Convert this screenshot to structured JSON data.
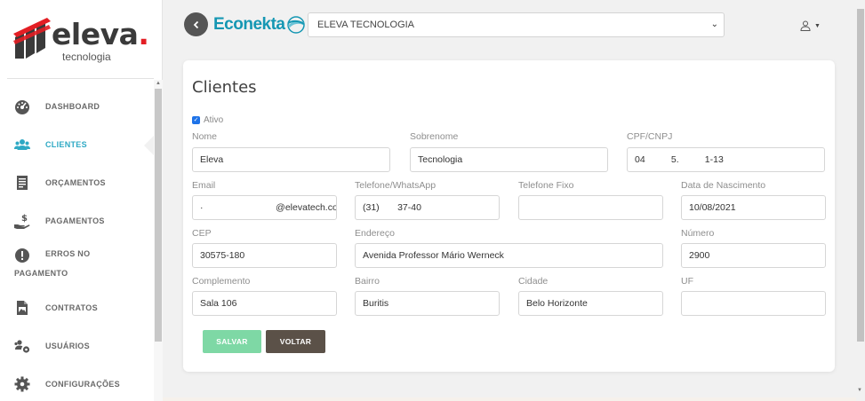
{
  "sidebar": {
    "logo_text": "eleva",
    "logo_dot": ".",
    "logo_sub": "tecnologia",
    "items": [
      {
        "label": "DASHBOARD",
        "icon": "dashboard-gauge-icon"
      },
      {
        "label": "CLIENTES",
        "icon": "users-icon",
        "active": true
      },
      {
        "label": "ORÇAMENTOS",
        "icon": "document-list-icon"
      },
      {
        "label": "PAGAMENTOS",
        "icon": "hand-dollar-icon"
      },
      {
        "label": "ERROS NO",
        "label2": "PAGAMENTO",
        "icon": "alert-circle-icon"
      },
      {
        "label": "CONTRATOS",
        "icon": "file-image-icon"
      },
      {
        "label": "USUÁRIOS",
        "icon": "users-gear-icon"
      },
      {
        "label": "CONFIGURAÇÕES",
        "icon": "gear-icon"
      }
    ]
  },
  "topbar": {
    "brand": "Econekta",
    "company": "ELEVA TECNOLOGIA"
  },
  "form": {
    "title": "Clientes",
    "ativo_label": "Ativo",
    "ativo_checked": true,
    "nome": {
      "label": "Nome",
      "value": "Eleva"
    },
    "sobrenome": {
      "label": "Sobrenome",
      "value": "Tecnologia"
    },
    "cpf": {
      "label": "CPF/CNPJ",
      "value": "04          5.          1-13"
    },
    "email": {
      "label": "Email",
      "value": "·                            @elevatech.com"
    },
    "telefone": {
      "label": "Telefone/WhatsApp",
      "value": "(31)       37-40"
    },
    "telefone_fixo": {
      "label": "Telefone Fixo",
      "value": ""
    },
    "nascimento": {
      "label": "Data de Nascimento",
      "value": "10/08/2021"
    },
    "cep": {
      "label": "CEP",
      "value": "30575-180"
    },
    "endereco": {
      "label": "Endereço",
      "value": "Avenida Professor Mário Werneck"
    },
    "numero": {
      "label": "Número",
      "value": "2900"
    },
    "complemento": {
      "label": "Complemento",
      "value": "Sala 106"
    },
    "bairro": {
      "label": "Bairro",
      "value": "Buritis"
    },
    "cidade": {
      "label": "Cidade",
      "value": "Belo Horizonte"
    },
    "uf": {
      "label": "UF",
      "value": ""
    },
    "save_label": "SALVAR",
    "back_label": "VOLTAR"
  },
  "colors": {
    "accent": "#2ea9c4",
    "save": "#7ed8a5",
    "back": "#5b5148",
    "logo_red": "#e31e24"
  }
}
